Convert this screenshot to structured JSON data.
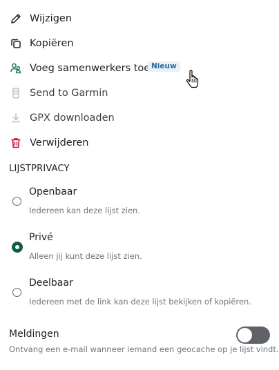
{
  "menu": {
    "items": [
      {
        "label": "Wijzigen",
        "icon": "pencil-icon"
      },
      {
        "label": "Kopiëren",
        "icon": "copy-icon"
      },
      {
        "label": "Voeg samenwerkers toe",
        "icon": "collaborators-icon",
        "badge": "Nieuw"
      },
      {
        "label": "Send to Garmin",
        "icon": "garmin-device-icon"
      },
      {
        "label": "GPX downloaden",
        "icon": "download-icon"
      },
      {
        "label": "Verwijderen",
        "icon": "trash-icon"
      }
    ]
  },
  "privacy": {
    "heading": "LIJSTPRIVACY",
    "options": [
      {
        "title": "Openbaar",
        "description": "Iedereen kan deze lijst zien.",
        "selected": false
      },
      {
        "title": "Privé",
        "description": "Alleen jij kunt deze lijst zien.",
        "selected": true
      },
      {
        "title": "Deelbaar",
        "description": "Iedereen met de link kan deze lijst bekijken of kopiëren.",
        "selected": false
      }
    ]
  },
  "notifications": {
    "title": "Meldingen",
    "description": "Ontvang een e-mail wanneer iemand een geocache op je lijst vindt.",
    "enabled": false
  },
  "colors": {
    "accent_green": "#0b5e42",
    "collab_icon_green": "#1e7a4e",
    "danger_red": "#c8102e",
    "badge_bg": "#e8f0f8",
    "badge_text": "#2d6a9a",
    "toggle_off": "#5f6368"
  }
}
